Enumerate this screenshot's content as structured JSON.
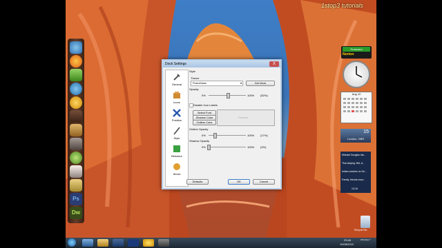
{
  "watermark": "1stop3 tutorials",
  "window": {
    "title": "Dock Settings",
    "close_glyph": "X",
    "nav": [
      {
        "label": "General",
        "icon": "wrench-icon"
      },
      {
        "label": "Icons",
        "icon": "box-icon"
      },
      {
        "label": "Position",
        "icon": "move-icon"
      },
      {
        "label": "Style",
        "icon": "brush-icon"
      },
      {
        "label": "Behavior",
        "icon": "behavior-icon"
      },
      {
        "label": "About",
        "icon": "info-icon"
      }
    ],
    "style_heading": "Style",
    "theme_label": "Theme",
    "theme_value": "ProtoGlass",
    "get_more": "Get More",
    "opacity_label": "Opacity",
    "opacity_min": "0%",
    "opacity_max": "100%",
    "opacity_value": "(52%)",
    "disable_icon_labels": "Disable Icon Labels",
    "select_font": "Select Font",
    "shadow_color": "Shadow Color",
    "outline_color": "Outline Color",
    "preview_text": "Preview",
    "outline_opacity_label": "Outline Opacity",
    "outline_min": "0%",
    "outline_max": "100%",
    "outline_value": "(17%)",
    "shadow_opacity_label": "Shadow Opacity",
    "shadow_min": "0%",
    "shadow_max": "100%",
    "shadow_value": "(0%)",
    "defaults": "Defaults",
    "ok": "OK",
    "cancel": "Cancel",
    "opacity_level": 0.52,
    "outline_level": 0.17,
    "shadow_level": 0.0
  },
  "gadgets": {
    "norton_status": "Protected",
    "norton_brand": "Norton",
    "calendar_month": "Aug 10",
    "weather_temp": "15",
    "weather_city": "London, GBR",
    "news_1": "Michael Douglas dia...",
    "news_2": "Thai staying: Brit, A...",
    "news_3": "Indian crashes on De...",
    "news_4": "Family, friends mour...",
    "news_pager": "13-16"
  },
  "taskbar": {
    "clock_time": "23:46",
    "clock_date": "10/08/2010",
    "os_label": "Windows 7"
  },
  "recycle_bin": "Recycle Bin"
}
